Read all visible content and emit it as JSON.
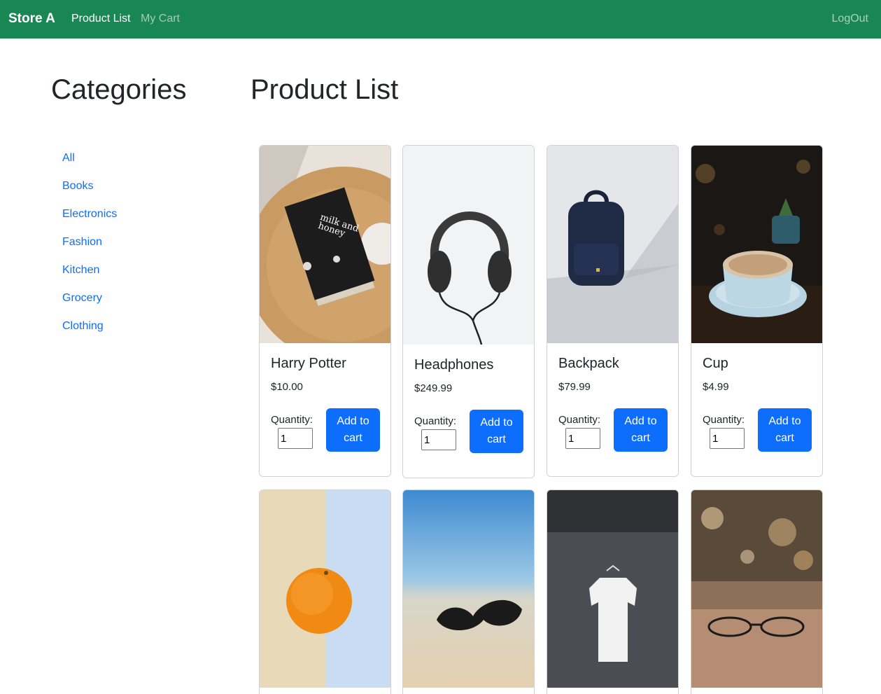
{
  "navbar": {
    "brand": "Store A",
    "links": [
      {
        "label": "Product List",
        "active": true
      },
      {
        "label": "My Cart",
        "active": false
      }
    ],
    "logout": "LogOut"
  },
  "sidebar": {
    "heading": "Categories",
    "categories": [
      "All",
      "Books",
      "Electronics",
      "Fashion",
      "Kitchen",
      "Grocery",
      "Clothing"
    ]
  },
  "main": {
    "heading": "Product List",
    "quantity_label": "Quantity:",
    "add_label": "Add to cart",
    "products": [
      {
        "name": "Harry Potter",
        "price": "$10.00",
        "qty": "1",
        "image": "book-photo"
      },
      {
        "name": "Headphones",
        "price": "$249.99",
        "qty": "1",
        "image": "headphones-photo"
      },
      {
        "name": "Backpack",
        "price": "$79.99",
        "qty": "1",
        "image": "backpack-photo"
      },
      {
        "name": "Cup",
        "price": "$4.99",
        "qty": "1",
        "image": "coffee-cup-photo"
      },
      {
        "image": "orange-photo"
      },
      {
        "image": "sunglasses-photo"
      },
      {
        "image": "tshirt-photo"
      },
      {
        "image": "eyeglasses-photo"
      }
    ]
  },
  "colors": {
    "navbar_bg": "#198754",
    "primary": "#0d6efd",
    "text": "#212529"
  }
}
